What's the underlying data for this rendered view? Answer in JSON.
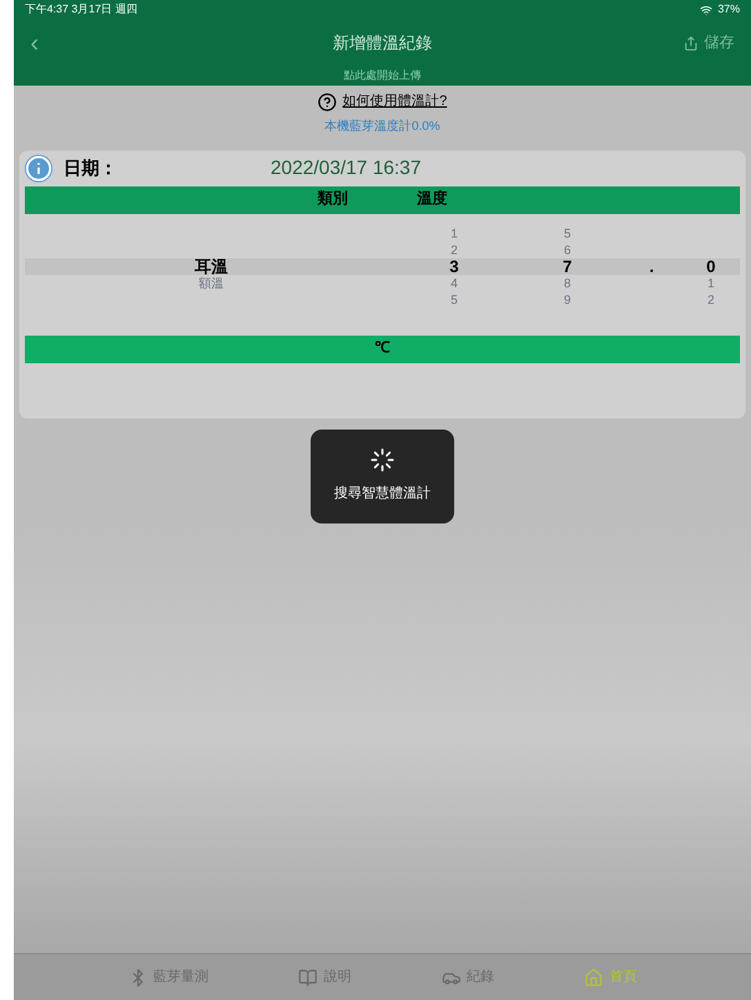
{
  "status_bar": {
    "time": "下午4:37  3月17日 週四",
    "battery": "37%"
  },
  "nav": {
    "back": "‹",
    "title": "新增體溫紀錄",
    "action": "儲存",
    "subtitle": "點此處開始上傳"
  },
  "notice": {
    "help": "如何使用體溫計?",
    "status": "本機藍芽溫度計0.0%"
  },
  "record": {
    "date_label": "日期：",
    "date_value": "2022/03/17 16:37",
    "headers": [
      "類別",
      "溫度"
    ],
    "unit": "℃",
    "picker_columns": [
      [
        {
          "text": "耳溫",
          "selected": true
        },
        {
          "text": "額溫",
          "selected": false
        }
      ],
      [
        {
          "text": "1",
          "selected": false
        },
        {
          "text": "2",
          "selected": false
        },
        {
          "text": "3",
          "selected": true
        },
        {
          "text": "4",
          "selected": false
        },
        {
          "text": "5",
          "selected": false
        }
      ],
      [
        {
          "text": "5",
          "selected": false
        },
        {
          "text": "6",
          "selected": false
        },
        {
          "text": "7",
          "selected": true
        },
        {
          "text": "8",
          "selected": false
        },
        {
          "text": "9",
          "selected": false
        }
      ],
      [
        {
          "text": ".",
          "selected": true
        }
      ],
      [
        {
          "text": "0",
          "selected": true
        },
        {
          "text": "1",
          "selected": false
        },
        {
          "text": "2",
          "selected": false
        }
      ]
    ]
  },
  "toast": {
    "text": "搜尋智慧體溫計"
  },
  "tabs": [
    {
      "label": "藍芽量測",
      "selected": false
    },
    {
      "label": "說明",
      "selected": false
    },
    {
      "label": "紀錄",
      "selected": false
    },
    {
      "label": "首頁",
      "selected": true
    }
  ]
}
